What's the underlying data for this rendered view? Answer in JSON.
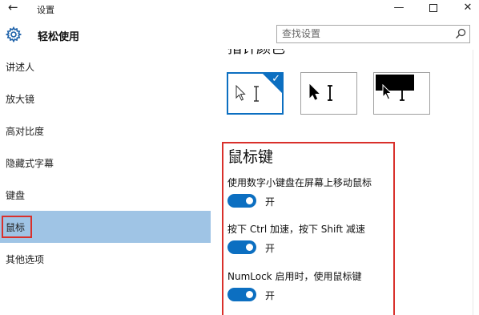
{
  "window": {
    "title": "设置"
  },
  "header": {
    "title": "轻松使用",
    "search_placeholder": "查找设置"
  },
  "sidebar": {
    "items": [
      {
        "label": "讲述人"
      },
      {
        "label": "放大镜"
      },
      {
        "label": "高对比度"
      },
      {
        "label": "隐藏式字幕"
      },
      {
        "label": "键盘"
      },
      {
        "label": "鼠标",
        "selected": true
      },
      {
        "label": "其他选项"
      }
    ]
  },
  "main": {
    "pointer_color_heading": "指针颜色",
    "mouse_keys": {
      "title": "鼠标键",
      "options": [
        {
          "label": "使用数字小键盘在屏幕上移动鼠标",
          "state": "开",
          "on": true
        },
        {
          "label": "按下 Ctrl 加速，按下 Shift 减速",
          "state": "开",
          "on": true
        },
        {
          "label": "NumLock 启用时，使用鼠标键",
          "state": "开",
          "on": true
        }
      ]
    }
  },
  "colors": {
    "accent": "#0c6fc1",
    "selection": "#9fc4e5",
    "highlight": "#d9302b"
  }
}
